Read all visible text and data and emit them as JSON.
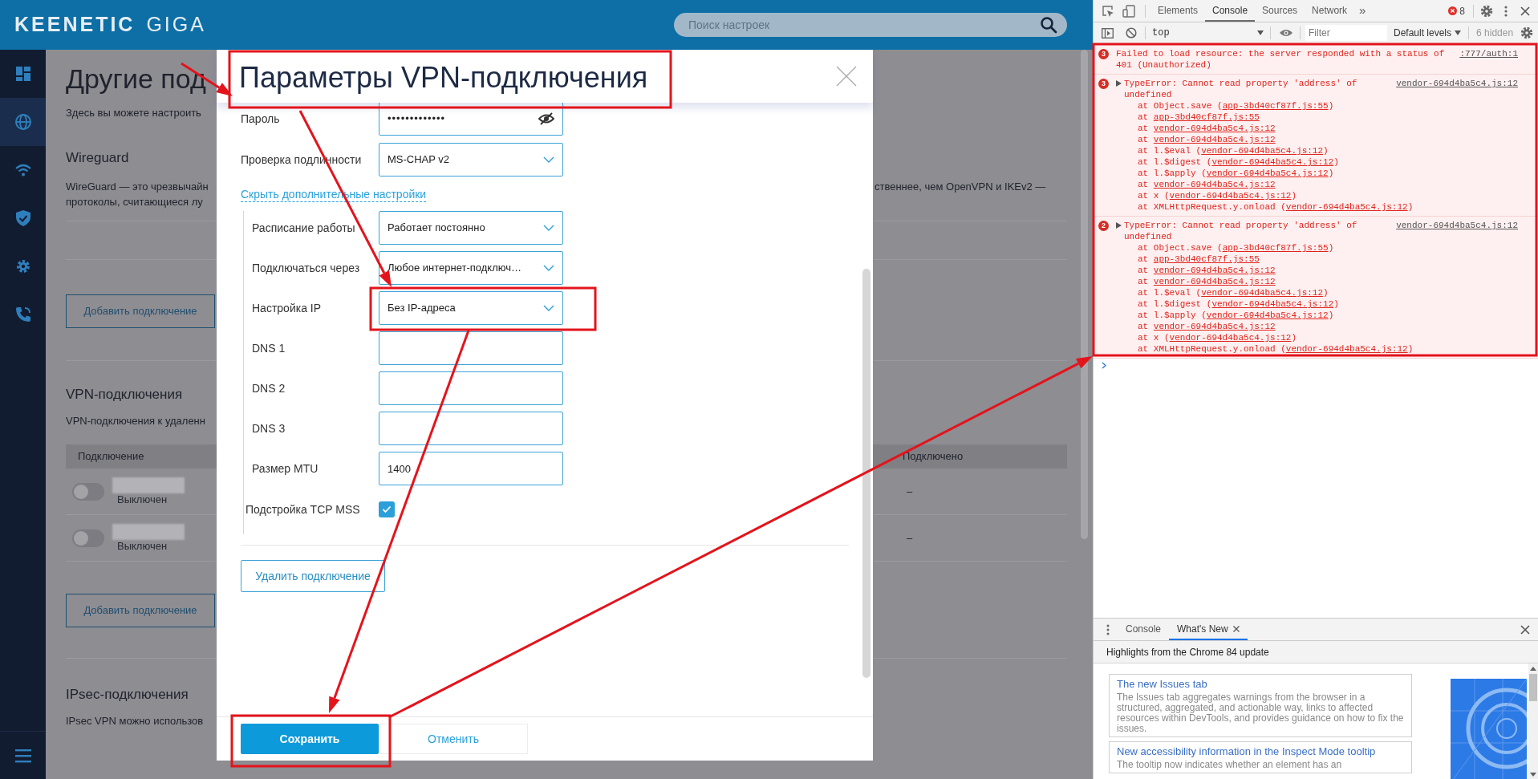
{
  "header": {
    "logo": "KEENETIC",
    "model": "GIGA",
    "search": {
      "placeholder": "Поиск настроек"
    }
  },
  "sidebar": {
    "items": [
      {
        "kind": "dashboard",
        "selected": false
      },
      {
        "kind": "globe",
        "selected": true
      },
      {
        "kind": "wifi",
        "selected": false
      },
      {
        "kind": "shield",
        "selected": false
      },
      {
        "kind": "gear",
        "selected": false
      },
      {
        "kind": "phone",
        "selected": false
      }
    ]
  },
  "page": {
    "title": "Другие под",
    "subtitle": "Здесь вы можете настроить",
    "wireguard": {
      "title": "Wireguard",
      "text_left": [
        "WireGuard — это чрезвычайн",
        "протоколы, считающиеся лу"
      ],
      "text_right": "ственнее, чем OpenVPN и IKEv2 —",
      "add_button": "Добавить подключение"
    },
    "vpn": {
      "title": "VPN-подключения",
      "subtitle": "VPN-подключения к удаленн",
      "columns": [
        "Подключение",
        "Подключено"
      ],
      "rows": [
        {
          "on": false,
          "status": "Выключен",
          "connected": "–"
        },
        {
          "on": false,
          "status": "Выключен",
          "connected": "–"
        }
      ],
      "add_button": "Добавить подключение"
    },
    "ipsec": {
      "title": "IPsec-подключения",
      "subtitle": "IPsec VPN можно использов"
    }
  },
  "dialog": {
    "title": "Параметры VPN-подключения",
    "fields": [
      {
        "kind": "password",
        "label": "Пароль",
        "value": "•••••••••••••"
      },
      {
        "kind": "select",
        "label": "Проверка подлинности",
        "value": "MS-CHAP v2"
      }
    ],
    "advanced_link": "Скрыть дополнительные настройки",
    "advanced_fields": [
      {
        "kind": "select",
        "label": "Расписание работы",
        "value": "Работает постоянно"
      },
      {
        "kind": "select",
        "label": "Подключаться через",
        "value": "Любое интернет-подключ…"
      },
      {
        "kind": "select",
        "label": "Настройка IP",
        "value": "Без IP-адреса"
      },
      {
        "kind": "text",
        "label": "DNS 1"
      },
      {
        "kind": "text",
        "label": "DNS 2"
      },
      {
        "kind": "text",
        "label": "DNS 3"
      },
      {
        "kind": "text",
        "label": "Размер MTU",
        "value": "1400"
      },
      {
        "kind": "checkbox",
        "label": "Подстройка TCP MSS",
        "checked": true
      }
    ],
    "delete_button": "Удалить подключение",
    "save_button": "Сохранить",
    "cancel_button": "Отменить"
  },
  "devtools": {
    "tabs": [
      {
        "label": "Elements",
        "selected": false
      },
      {
        "label": "Console",
        "selected": true
      },
      {
        "label": "Sources",
        "selected": false
      },
      {
        "label": "Network",
        "selected": false
      }
    ],
    "more": "»",
    "error_count": "8",
    "context": "top",
    "filter": {
      "placeholder": "Filter"
    },
    "levels": "Default levels",
    "hidden": "6 hidden",
    "messages": [
      {
        "count": "3",
        "text": "Failed to load resource: the server responded with a status of 401 (Unauthorized)",
        "source": ":777/auth:1"
      },
      {
        "count": "3",
        "text": "TypeError: Cannot read property 'address' of undefined",
        "source": "vendor-694d4ba5c4.js:12",
        "stack": [
          {
            "text": "at Object.save (",
            "link": "app-3bd40cf87f.js:55",
            "end": ")"
          },
          {
            "text": "at ",
            "link": "app-3bd40cf87f.js:55"
          },
          {
            "text": "at ",
            "link": "vendor-694d4ba5c4.js:12"
          },
          {
            "text": "at ",
            "link": "vendor-694d4ba5c4.js:12"
          },
          {
            "text": "at l.$eval (",
            "link": "vendor-694d4ba5c4.js:12",
            "end": ")"
          },
          {
            "text": "at l.$digest (",
            "link": "vendor-694d4ba5c4.js:12",
            "end": ")"
          },
          {
            "text": "at l.$apply (",
            "link": "vendor-694d4ba5c4.js:12",
            "end": ")"
          },
          {
            "text": "at ",
            "link": "vendor-694d4ba5c4.js:12"
          },
          {
            "text": "at x (",
            "link": "vendor-694d4ba5c4.js:12",
            "end": ")"
          },
          {
            "text": "at XMLHttpRequest.y.onload (",
            "link": "vendor-694d4ba5c4.js:12",
            "end": ")"
          }
        ]
      },
      {
        "count": "2",
        "text": "TypeError: Cannot read property 'address' of undefined",
        "source": "vendor-694d4ba5c4.js:12",
        "stack": [
          {
            "text": "at Object.save (",
            "link": "app-3bd40cf87f.js:55",
            "end": ")"
          },
          {
            "text": "at ",
            "link": "app-3bd40cf87f.js:55"
          },
          {
            "text": "at ",
            "link": "vendor-694d4ba5c4.js:12"
          },
          {
            "text": "at ",
            "link": "vendor-694d4ba5c4.js:12"
          },
          {
            "text": "at l.$eval (",
            "link": "vendor-694d4ba5c4.js:12",
            "end": ")"
          },
          {
            "text": "at l.$digest (",
            "link": "vendor-694d4ba5c4.js:12",
            "end": ")"
          },
          {
            "text": "at l.$apply (",
            "link": "vendor-694d4ba5c4.js:12",
            "end": ")"
          },
          {
            "text": "at ",
            "link": "vendor-694d4ba5c4.js:12"
          },
          {
            "text": "at x (",
            "link": "vendor-694d4ba5c4.js:12",
            "end": ")"
          },
          {
            "text": "at XMLHttpRequest.y.onload (",
            "link": "vendor-694d4ba5c4.js:12",
            "end": ")"
          }
        ]
      }
    ],
    "drawer": {
      "tabs": [
        {
          "label": "Console",
          "selected": false
        },
        {
          "label": "What's New",
          "selected": true
        }
      ],
      "heading": "Highlights from the Chrome 84 update",
      "cards": [
        {
          "title": "The new Issues tab",
          "text": "The Issues tab aggregates warnings from the browser in a structured, aggregated, and actionable way, links to affected resources within DevTools, and provides guidance on how to fix the issues."
        },
        {
          "title": "New accessibility information in the Inspect Mode tooltip",
          "text": "The tooltip now indicates whether an element has an"
        }
      ]
    }
  }
}
